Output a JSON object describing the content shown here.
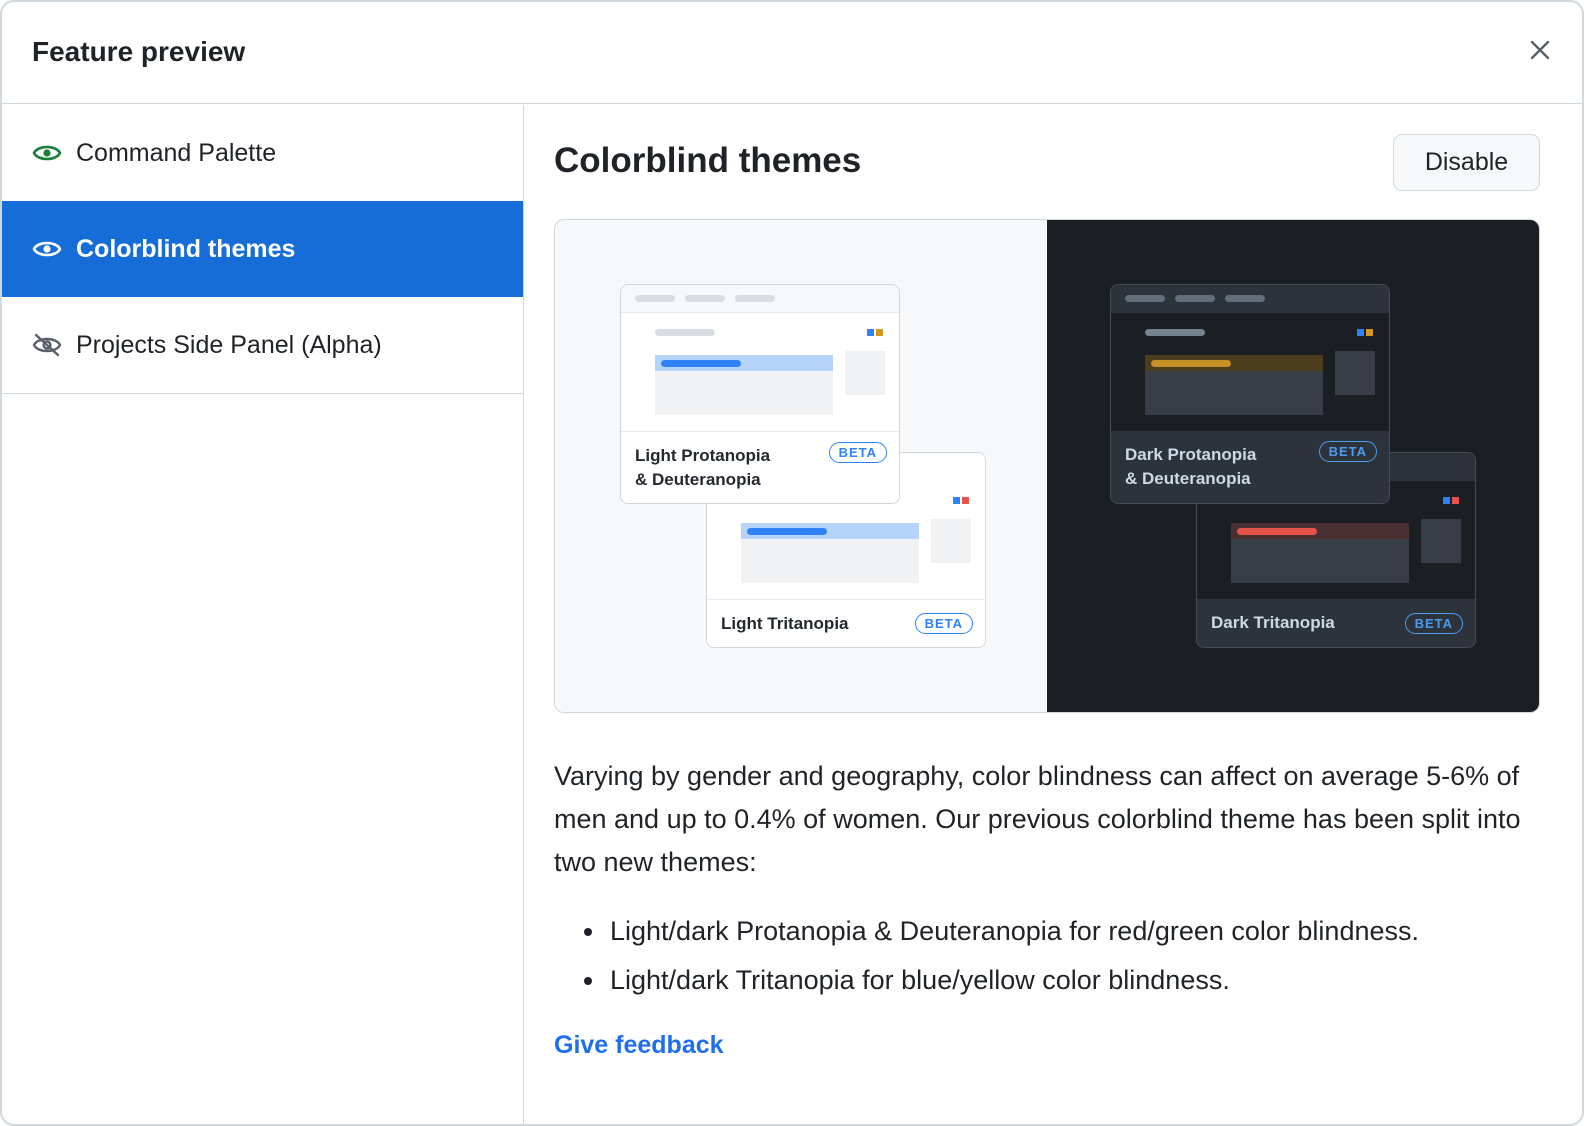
{
  "dialog": {
    "title": "Feature preview"
  },
  "sidebar": {
    "items": [
      {
        "label": "Command Palette",
        "icon": "eye-icon",
        "active": false
      },
      {
        "label": "Colorblind themes",
        "icon": "eye-icon",
        "active": true
      },
      {
        "label": "Projects Side Panel (Alpha)",
        "icon": "eye-closed-icon",
        "active": false
      }
    ]
  },
  "main": {
    "title": "Colorblind themes",
    "disable_label": "Disable",
    "preview": {
      "cards": [
        {
          "label_line1": "Light Protanopia",
          "label_line2": "& Deuteranopia",
          "badge": "BETA"
        },
        {
          "label_line1": "Light Tritanopia",
          "badge": "BETA"
        },
        {
          "label_line1": "Dark Protanopia",
          "label_line2": "& Deuteranopia",
          "badge": "BETA"
        },
        {
          "label_line1": "Dark Tritanopia",
          "badge": "BETA"
        }
      ]
    },
    "description": "Varying by gender and geography, color blindness can affect on average 5-6% of men and up to 0.4% of women. Our previous colorblind theme has been split into two new themes:",
    "bullets": [
      "Light/dark Protanopia & Deuteranopia for red/green color blindness.",
      "Light/dark Tritanopia for blue/yellow color blindness."
    ],
    "feedback_label": "Give feedback"
  },
  "colors": {
    "accent": "#176dd8",
    "eye_green": "#1a7f37",
    "link": "#1f6feb"
  }
}
